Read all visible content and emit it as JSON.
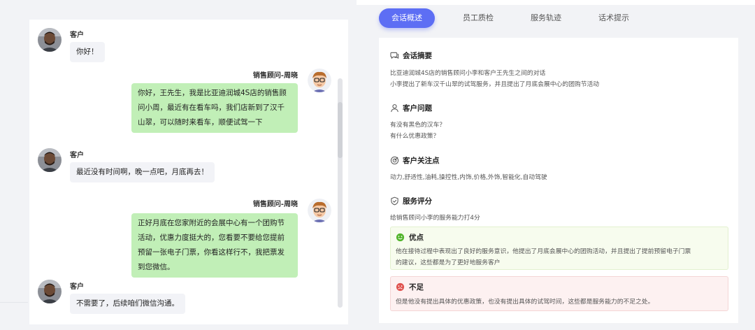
{
  "chat": {
    "messages": [
      {
        "role": "customer",
        "sender": "客户",
        "lines": [
          "你好！"
        ]
      },
      {
        "role": "agent",
        "sender": "销售顾问-周晓",
        "lines": [
          "你好，王先生，我是比亚迪润城4S店的销售顾",
          "问小周，最近有在看车吗，我们店新到了汉千",
          "山翠，可以随时来看车，顺便试驾一下"
        ]
      },
      {
        "role": "customer",
        "sender": "客户",
        "lines": [
          "最近没有时间啊，晚一点吧，月底再去！"
        ]
      },
      {
        "role": "agent",
        "sender": "销售顾问-周晓",
        "lines": [
          "正好月底在您家附近的会展中心有一个团购节",
          "活动，优惠力度挺大的，您看要不要给您提前",
          "预留一张电子门票，你看这样行不，我把票发",
          "到您微信。"
        ]
      },
      {
        "role": "customer",
        "sender": "客户",
        "lines": [
          "不需要了，后续咱们微信沟通。"
        ]
      }
    ]
  },
  "tabs": [
    {
      "label": "会话概述",
      "active": true
    },
    {
      "label": "员工质检",
      "active": false
    },
    {
      "label": "服务轨迹",
      "active": false
    },
    {
      "label": "话术提示",
      "active": false
    }
  ],
  "summary": {
    "title": "会话摘要",
    "lines": [
      "比亚迪润城4S店的销售顾问小李和客户王先生之间的对话",
      "小李提出了新车汉千山翠的试驾服务，并且提出了月底会展中心的团购节活动"
    ]
  },
  "questions": {
    "title": "客户问题",
    "lines": [
      "有没有黑色的汉车？",
      "有什么优惠政策？"
    ]
  },
  "focus": {
    "title": "客户关注点",
    "text": "动力,舒适性,油耗,操控性,内饰,价格,外饰,智能化,自动驾驶"
  },
  "score": {
    "title": "服务评分",
    "text": "给销售顾问小李的服务能力打4分",
    "good": {
      "title": "优点",
      "lines": [
        "他在接待过程中表现出了良好的服务意识，他提出了月底会展中心的团购活动，并且提出了提前预留电子门票",
        "的建议，这些都是为了更好地服务客户"
      ]
    },
    "bad": {
      "title": "不足",
      "lines": [
        "但是他没有提出具体的优惠政策，也没有提出具体的试驾时间，这些都是服务能力的不足之处。"
      ]
    }
  },
  "colors": {
    "accent": "#5d6ef4",
    "agent_bubble": "#c1efb7",
    "customer_bubble": "#f2f3f7",
    "good_icon": "#52b52c",
    "bad_icon": "#e0534f"
  }
}
